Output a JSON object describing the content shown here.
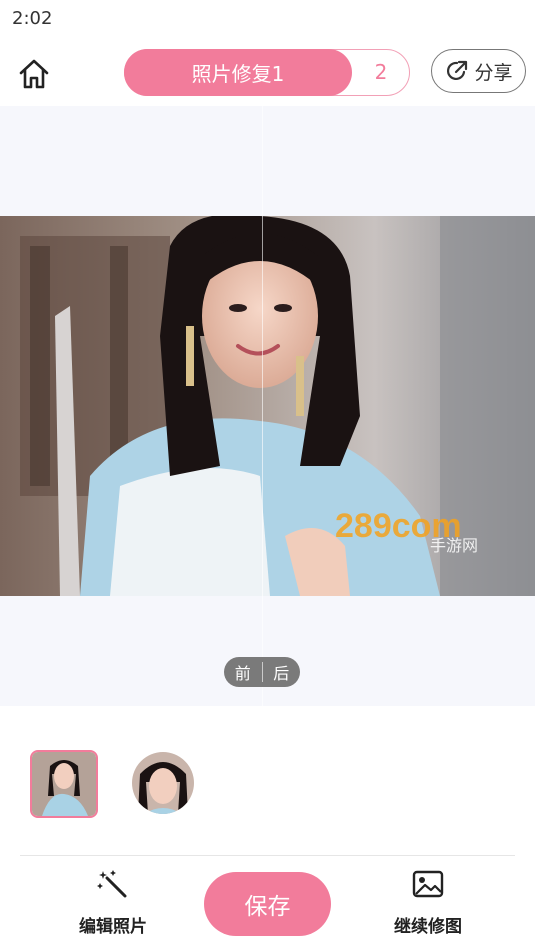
{
  "status_bar": {
    "time": "2:02"
  },
  "header": {
    "tabs": [
      {
        "label": "照片修复1",
        "active": true
      },
      {
        "label": "2",
        "active": false
      }
    ],
    "share_label": "分享"
  },
  "preview": {
    "before_label": "前",
    "after_label": "后",
    "watermark_text": "289com",
    "watermark_sub": "手游网"
  },
  "bottom": {
    "edit_label": "编辑照片",
    "save_label": "保存",
    "continue_label": "继续修图"
  },
  "colors": {
    "accent": "#f27c9b",
    "preview_bg": "#f6f7fc"
  }
}
